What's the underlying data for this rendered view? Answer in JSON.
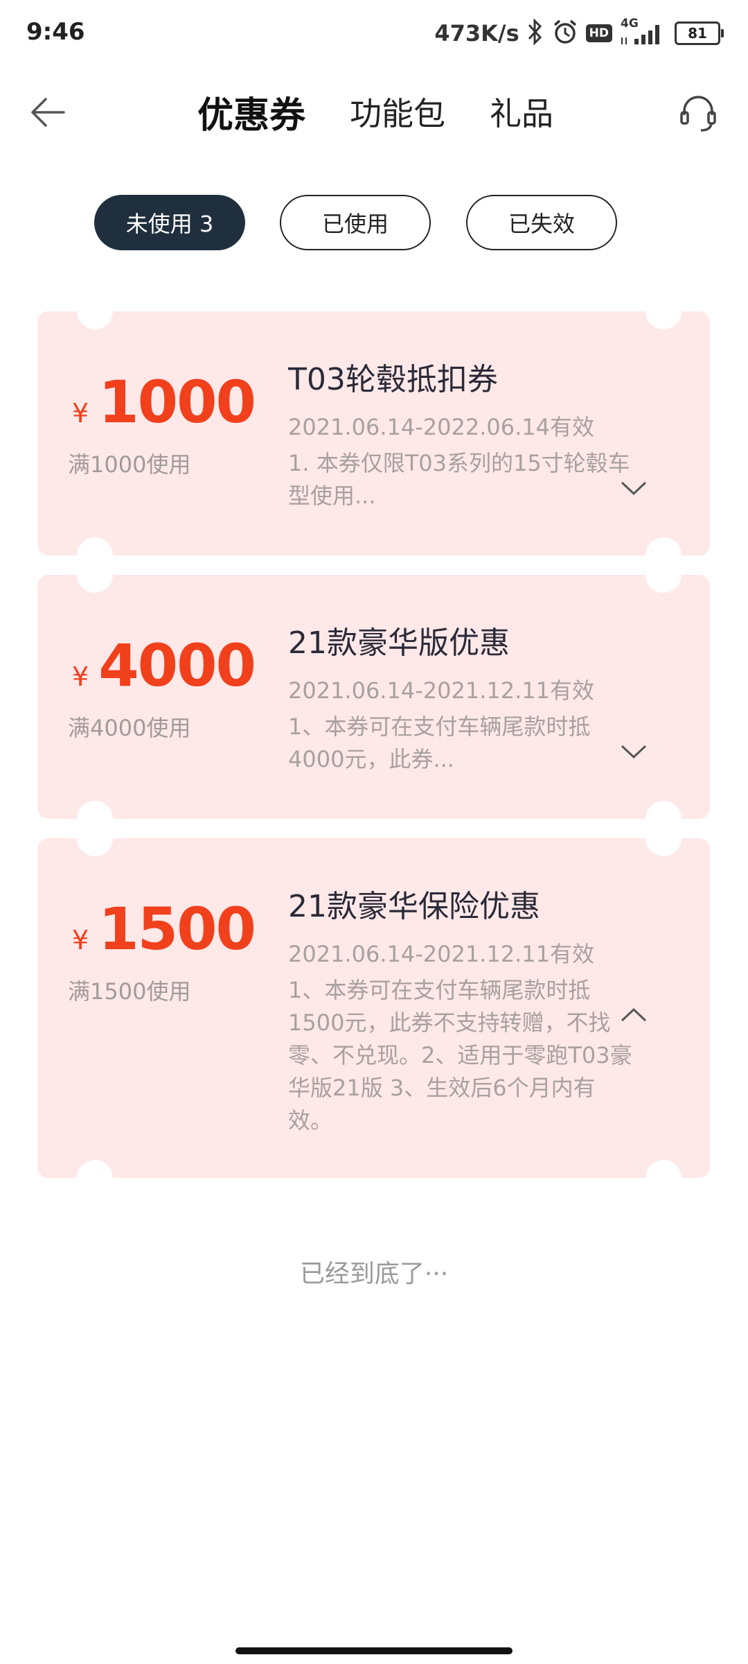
{
  "status_bar": {
    "time": "9:46",
    "net_speed": "473K/s",
    "signal_label": "4G",
    "hd_label": "HD",
    "battery": "81",
    "icons": [
      "bluetooth-icon",
      "alarm-icon",
      "hd-icon",
      "signal-icon",
      "battery-icon"
    ]
  },
  "header": {
    "tabs": [
      {
        "label": "优惠券",
        "active": true
      },
      {
        "label": "功能包",
        "active": false
      },
      {
        "label": "礼品",
        "active": false
      }
    ],
    "icons": [
      "back-arrow-icon",
      "headset-icon"
    ]
  },
  "filters": [
    {
      "label": "未使用 3",
      "active": true
    },
    {
      "label": "已使用",
      "active": false
    },
    {
      "label": "已失效",
      "active": false
    }
  ],
  "coupons": [
    {
      "currency": "¥",
      "amount": "1000",
      "threshold": "满1000使用",
      "title": "T03轮毂抵扣券",
      "validity": "2021.06.14-2022.06.14有效",
      "description": "1. 本券仅限T03系列的15寸轮毂车型使用...",
      "expanded": false
    },
    {
      "currency": "¥",
      "amount": "4000",
      "threshold": "满4000使用",
      "title": "21款豪华版优惠",
      "validity": "2021.06.14-2021.12.11有效",
      "description": "1、本券可在支付车辆尾款时抵4000元，此券...",
      "expanded": false
    },
    {
      "currency": "¥",
      "amount": "1500",
      "threshold": "满1500使用",
      "title": "21款豪华保险优惠",
      "validity": "2021.06.14-2021.12.11有效",
      "description": "1、本券可在支付车辆尾款时抵1500元，此券不支持转赠，不找零、不兑现。2、适用于零跑T03豪华版21版 3、生效后6个月内有效。",
      "expanded": true
    }
  ],
  "footer_tip": "已经到底了···",
  "colors": {
    "accent_red": "#f0401c",
    "card_bg": "#ffe8e8",
    "active_pill": "#1f2f3d"
  }
}
